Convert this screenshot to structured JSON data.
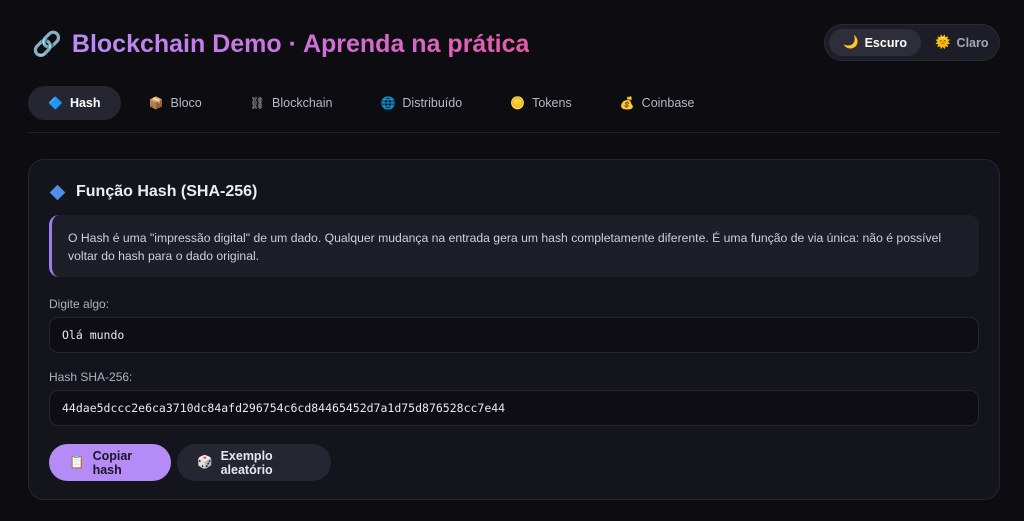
{
  "app": {
    "title": "Blockchain Demo · Aprenda na prática",
    "title_icon": "🔗"
  },
  "theme": {
    "options": [
      {
        "icon": "🌙",
        "label": "Escuro",
        "active": true
      },
      {
        "icon": "🌞",
        "label": "Claro",
        "active": false
      }
    ]
  },
  "tabs": [
    {
      "icon": "🔷",
      "label": "Hash",
      "active": true
    },
    {
      "icon": "📦",
      "label": "Bloco",
      "active": false
    },
    {
      "icon": "⛓",
      "label": "Blockchain",
      "active": false
    },
    {
      "icon": "🌐",
      "label": "Distribuído",
      "active": false
    },
    {
      "icon": "🪙",
      "label": "Tokens",
      "active": false
    },
    {
      "icon": "💰",
      "label": "Coinbase",
      "active": false
    }
  ],
  "card": {
    "title": "Função Hash (SHA-256)",
    "description": "O Hash é uma \"impressão digital\" de um dado. Qualquer mudança na entrada gera um hash completamente diferente. É uma função de via única: não é possível voltar do hash para o dado original.",
    "input_label": "Digite algo:",
    "input_value": "Olá mundo",
    "hash_label": "Hash SHA-256:",
    "hash_value": "44dae5dccc2e6ca3710dc84afd296754c6cd84465452d7a1d75d876528cc7e44",
    "copy_button": {
      "icon": "📋",
      "label": "Copiar hash"
    },
    "random_button": {
      "icon": "🎲",
      "label": "Exemplo aleatório"
    }
  },
  "colors": {
    "background": "#0c0c11",
    "card": "#14141c",
    "accent": "#b58cf5",
    "title_gradient_end": "#e65aa6"
  }
}
